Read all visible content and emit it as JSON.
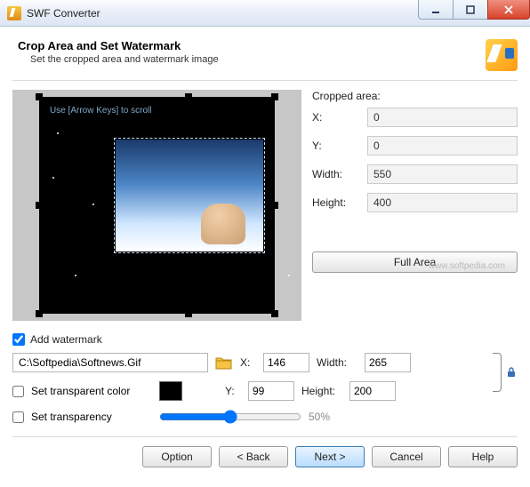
{
  "window": {
    "title": "SWF Converter"
  },
  "header": {
    "title": "Crop Area and Set Watermark",
    "subtitle": "Set the cropped area and watermark image"
  },
  "preview": {
    "hint": "Use [Arrow Keys] to scroll"
  },
  "cropped": {
    "section_label": "Cropped area:",
    "x_label": "X:",
    "x_value": "0",
    "y_label": "Y:",
    "y_value": "0",
    "w_label": "Width:",
    "w_value": "550",
    "h_label": "Height:",
    "h_value": "400",
    "full_btn": "Full Area",
    "watermark_txt": "www.softpedia.com"
  },
  "wm": {
    "add_label": "Add watermark",
    "add_checked": true,
    "path": "C:\\Softpedia\\Softnews.Gif",
    "x_label": "X:",
    "x_value": "146",
    "y_label": "Y:",
    "y_value": "99",
    "w_label": "Width:",
    "w_value": "265",
    "h_label": "Height:",
    "h_value": "200",
    "transp_color_label": "Set transparent color",
    "transp_color_checked": false,
    "color_value": "#000000",
    "transp_label": "Set transparency",
    "transp_checked": false,
    "transp_pct": "50%"
  },
  "footer": {
    "option": "Option",
    "back": "< Back",
    "next": "Next >",
    "cancel": "Cancel",
    "help": "Help"
  }
}
